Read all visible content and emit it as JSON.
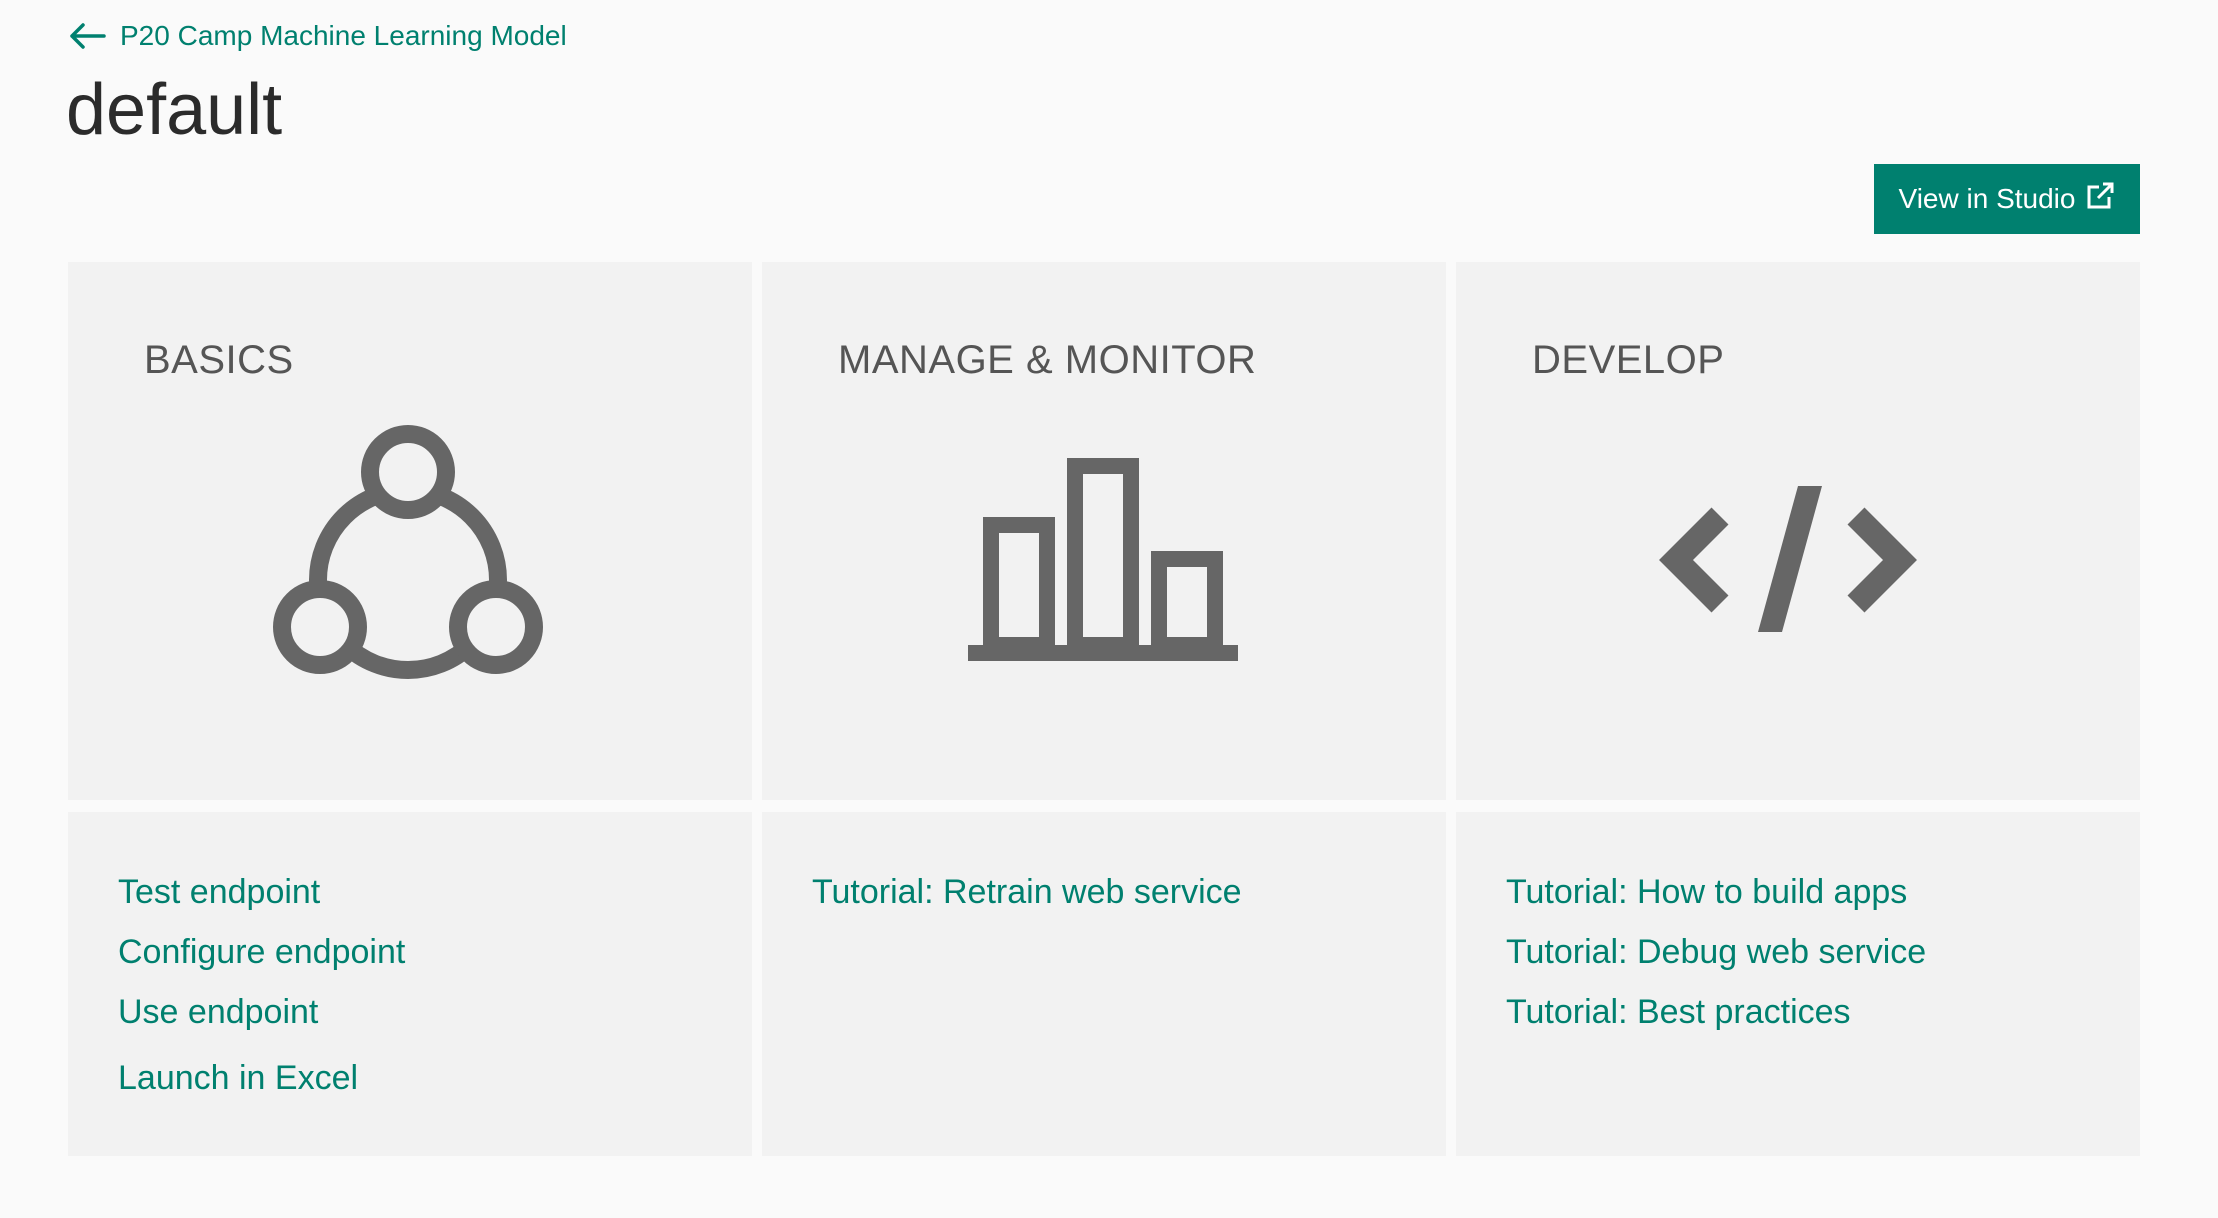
{
  "header": {
    "back_label": "P20 Camp Machine Learning Model",
    "title": "default",
    "studio_button_label": "View in Studio"
  },
  "tiles": [
    {
      "heading": "BASICS",
      "icon": "network-icon",
      "links": [
        "Test endpoint",
        "Configure endpoint",
        "Use endpoint",
        "Launch in Excel"
      ]
    },
    {
      "heading": "MANAGE & MONITOR",
      "icon": "bar-chart-icon",
      "links": [
        "Tutorial: Retrain web service"
      ]
    },
    {
      "heading": "DEVELOP",
      "icon": "code-icon",
      "links": [
        "Tutorial: How to build apps",
        "Tutorial: Debug web service",
        "Tutorial: Best practices"
      ]
    }
  ],
  "colors": {
    "accent": "#00806f",
    "tile_background": "#f2f2f2",
    "icon_gray": "#666666",
    "page_background": "#fafafa"
  }
}
